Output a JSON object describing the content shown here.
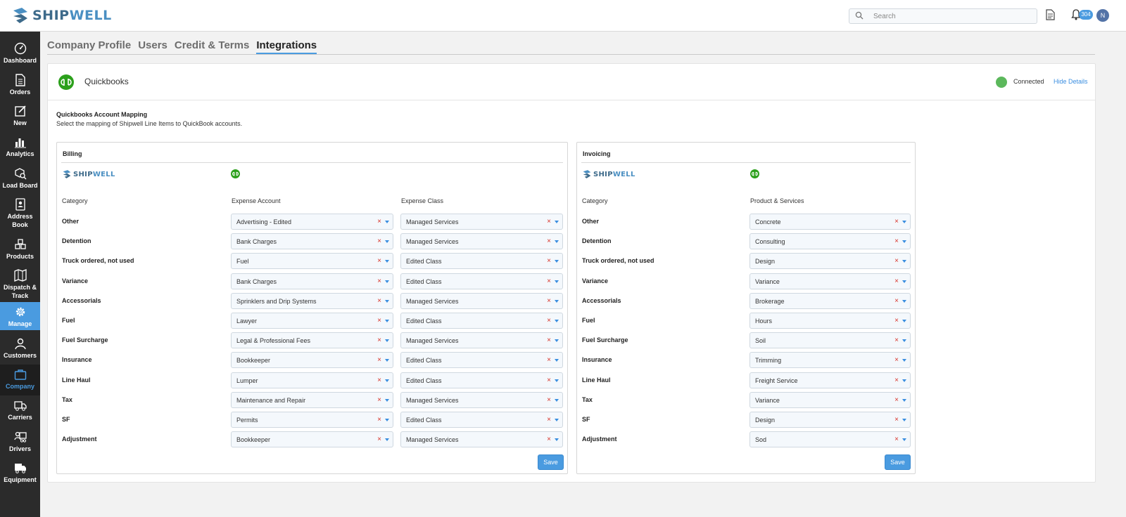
{
  "app": {
    "logo_ship": "SHIP",
    "logo_well": "WELL"
  },
  "header": {
    "search_placeholder": "Search",
    "notification_count": "304",
    "avatar_initial": "N"
  },
  "sidebar": {
    "items": [
      {
        "label": "Dashboard",
        "icon": "dashboard-icon"
      },
      {
        "label": "Orders",
        "icon": "orders-icon"
      },
      {
        "label": "New",
        "icon": "new-icon"
      },
      {
        "label": "Analytics",
        "icon": "analytics-icon"
      },
      {
        "label": "Load Board",
        "icon": "load-board-icon"
      },
      {
        "label": "Address Book",
        "icon": "address-book-icon"
      },
      {
        "label": "Products",
        "icon": "products-icon"
      },
      {
        "label": "Dispatch & Track",
        "icon": "map-icon"
      },
      {
        "label": "Manage",
        "icon": "gear-icon",
        "state": "active"
      },
      {
        "label": "Customers",
        "icon": "customers-icon"
      },
      {
        "label": "Company",
        "icon": "briefcase-icon",
        "state": "current"
      },
      {
        "label": "Carriers",
        "icon": "truck-icon"
      },
      {
        "label": "Drivers",
        "icon": "drivers-icon"
      },
      {
        "label": "Equipment",
        "icon": "equipment-icon"
      }
    ],
    "active_color": "#4a9be0"
  },
  "tabs": [
    "Company Profile",
    "Users",
    "Credit & Terms",
    "Integrations"
  ],
  "integration": {
    "name": "Quickbooks",
    "status": "Connected",
    "status_color": "#5cb85c",
    "toggle_label": "Hide Details",
    "mapping_title": "Quickbooks Account Mapping",
    "mapping_subtitle": "Select the mapping of Shipwell Line Items to QuickBook accounts.",
    "qb_brand_color": "#2ca01c"
  },
  "billing": {
    "title": "Billing",
    "columns": [
      "Category",
      "Expense Account",
      "Expense Class"
    ],
    "rows": [
      {
        "category": "Other",
        "account": "Advertising - Edited",
        "class": "Managed Services"
      },
      {
        "category": "Detention",
        "account": "Bank Charges",
        "class": "Managed Services"
      },
      {
        "category": "Truck ordered, not used",
        "account": "Fuel",
        "class": "Edited Class"
      },
      {
        "category": "Variance",
        "account": "Bank Charges",
        "class": "Edited Class"
      },
      {
        "category": "Accessorials",
        "account": "Sprinklers and Drip Systems",
        "class": "Managed Services"
      },
      {
        "category": "Fuel",
        "account": "Lawyer",
        "class": "Edited Class"
      },
      {
        "category": "Fuel Surcharge",
        "account": "Legal & Professional Fees",
        "class": "Managed Services"
      },
      {
        "category": "Insurance",
        "account": "Bookkeeper",
        "class": "Edited Class"
      },
      {
        "category": "Line Haul",
        "account": "Lumper",
        "class": "Edited Class"
      },
      {
        "category": "Tax",
        "account": "Maintenance and Repair",
        "class": "Managed Services"
      },
      {
        "category": "SF",
        "account": "Permits",
        "class": "Edited Class"
      },
      {
        "category": "Adjustment",
        "account": "Bookkeeper",
        "class": "Managed Services"
      }
    ],
    "save_label": "Save"
  },
  "invoicing": {
    "title": "Invoicing",
    "columns": [
      "Category",
      "Product & Services"
    ],
    "rows": [
      {
        "category": "Other",
        "product": "Concrete"
      },
      {
        "category": "Detention",
        "product": "Consulting"
      },
      {
        "category": "Truck ordered, not used",
        "product": "Design"
      },
      {
        "category": "Variance",
        "product": "Variance"
      },
      {
        "category": "Accessorials",
        "product": "Brokerage"
      },
      {
        "category": "Fuel",
        "product": "Hours"
      },
      {
        "category": "Fuel Surcharge",
        "product": "Soil"
      },
      {
        "category": "Insurance",
        "product": "Trimming"
      },
      {
        "category": "Line Haul",
        "product": "Freight Service"
      },
      {
        "category": "Tax",
        "product": "Variance"
      },
      {
        "category": "SF",
        "product": "Design"
      },
      {
        "category": "Adjustment",
        "product": "Sod"
      }
    ],
    "save_label": "Save"
  }
}
